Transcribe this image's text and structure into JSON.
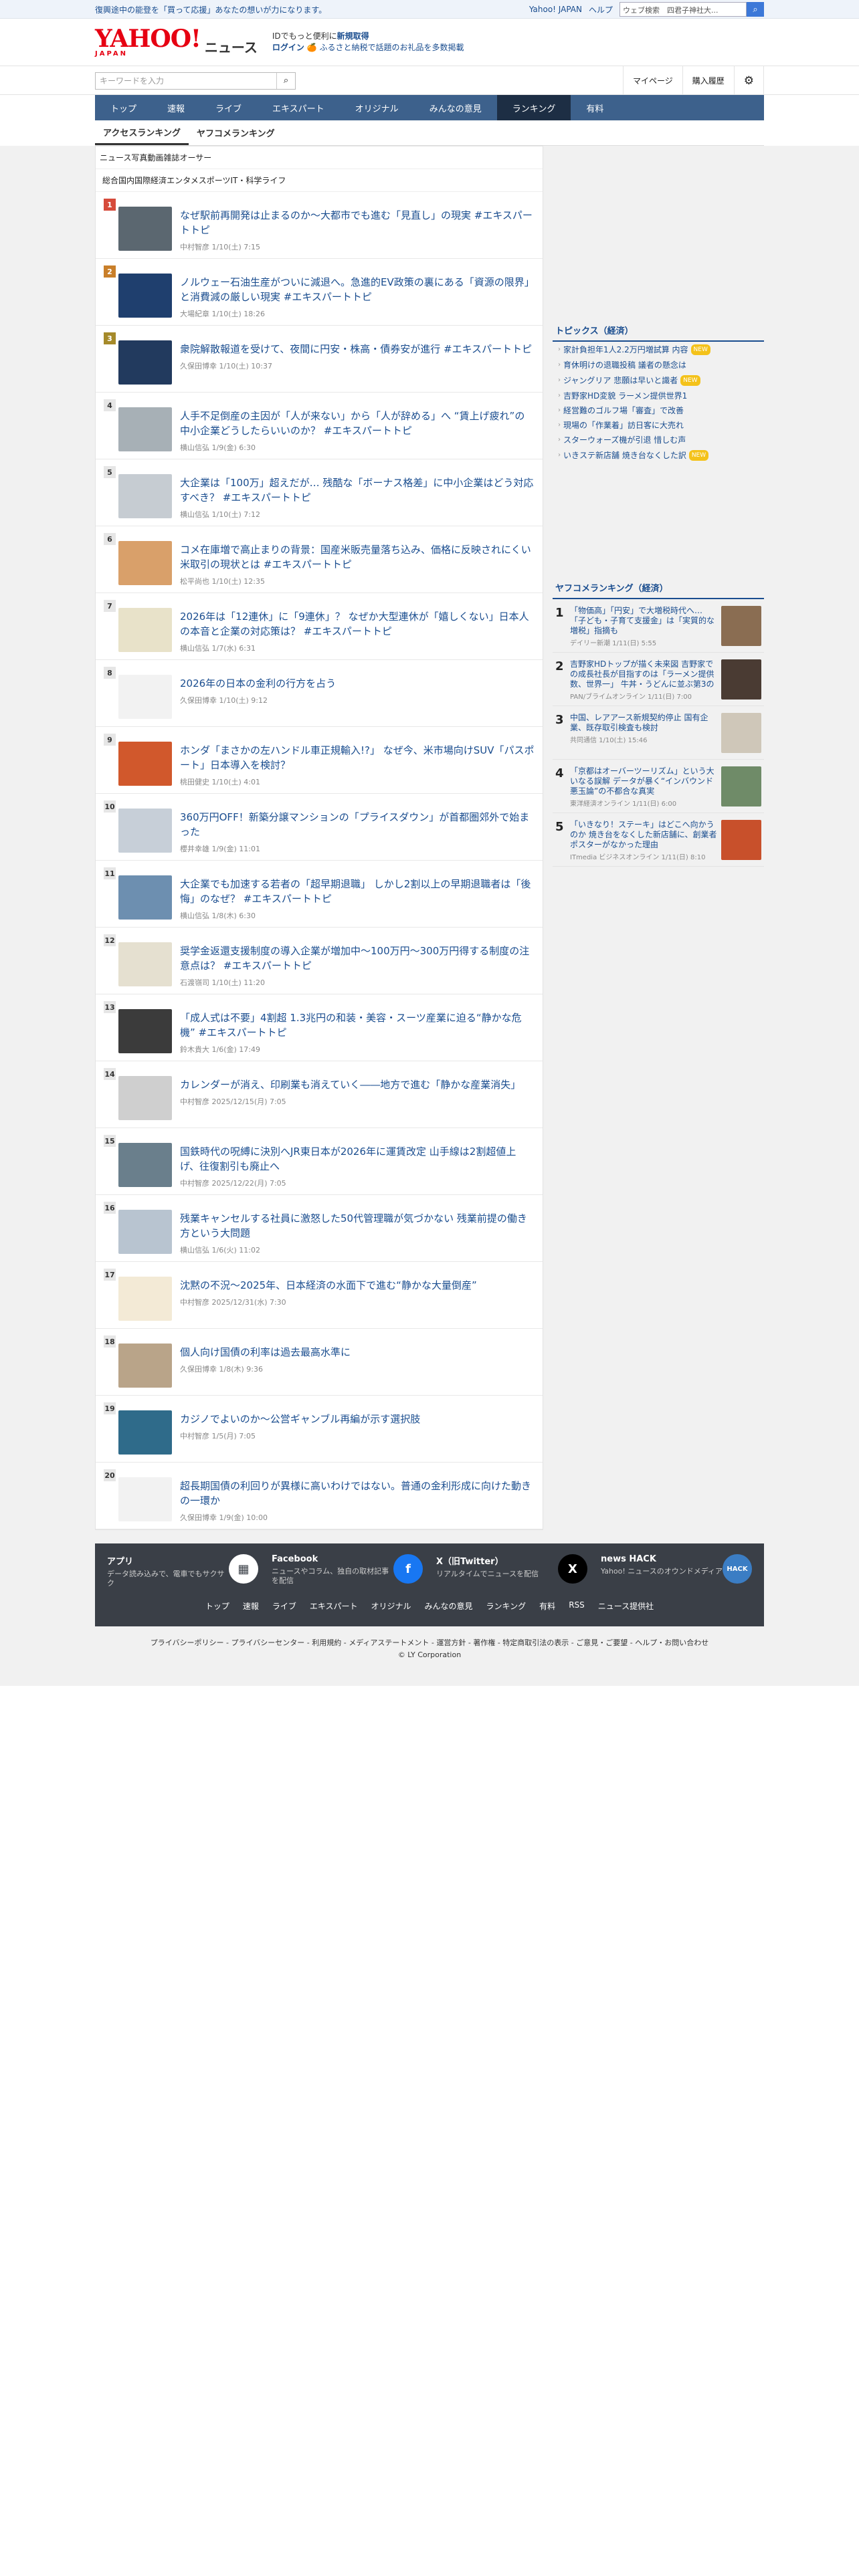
{
  "topbar": {
    "promo": "復興途中の能登を「買って応援」あなたの想いが力になります。",
    "yahoo_japan": "Yahoo! JAPAN",
    "help": "ヘルプ",
    "web_search": "ウェブ検索",
    "search_value": "四君子神社大..."
  },
  "header": {
    "logo_text": "YAHOO!",
    "logo_sub": "JAPAN",
    "logo_news": "ニュース",
    "pitch_line1_a": "IDでもっと便利に",
    "pitch_line1_b": "新規取得",
    "pitch_login": "ログイン",
    "pitch_line2": "ふるさと納税で話題のお礼品を多数掲載"
  },
  "search": {
    "placeholder": "キーワードを入力",
    "mypage": "マイページ",
    "history": "購入履歴"
  },
  "nav": [
    "トップ",
    "速報",
    "ライブ",
    "エキスパート",
    "オリジナル",
    "みんなの意見",
    "ランキング",
    "有料"
  ],
  "nav_active": 6,
  "subtabs": [
    "アクセスランキング",
    "ヤフコメランキング"
  ],
  "cat1": [
    "ニュース",
    "写真",
    "動画",
    "雑誌",
    "オーサー"
  ],
  "cat2": [
    "総合",
    "国内",
    "国際",
    "経済",
    "エンタメ",
    "スポーツ",
    "IT・科学",
    "ライフ"
  ],
  "ranking": [
    {
      "no": "1",
      "title": "なぜ駅前再開発は止まるのか～大都市でも進む「見直し」の現実 #エキスパートトピ",
      "meta": "中村智彦 1/10(土) 7:15"
    },
    {
      "no": "2",
      "title": "ノルウェー石油生産がついに減退へ。急進的EV政策の裏にある「資源の限界」と消費減の厳しい現実 #エキスパートトピ",
      "meta": "大場紀章 1/10(土) 18:26"
    },
    {
      "no": "3",
      "title": "衆院解散報道を受けて、夜間に円安・株高・債券安が進行 #エキスパートトピ",
      "meta": "久保田博幸 1/10(土) 10:37"
    },
    {
      "no": "4",
      "title": "人手不足倒産の主因が「人が来ない」から「人が辞める」へ “賃上げ疲れ”の中小企業どうしたらいいのか？ #エキスパートトピ",
      "meta": "横山信弘 1/9(金) 6:30"
    },
    {
      "no": "5",
      "title": "大企業は「100万」超えだが… 残酷な「ボーナス格差」に中小企業はどう対応すべき？ #エキスパートトピ",
      "meta": "横山信弘 1/10(土) 7:12"
    },
    {
      "no": "6",
      "title": "コメ在庫増で高止まりの背景：国産米販売量落ち込み、価格に反映されにくい米取引の現状とは #エキスパートトピ",
      "meta": "松平尚也 1/10(土) 12:35"
    },
    {
      "no": "7",
      "title": "2026年は「12連休」に「9連休」？ なぜか大型連休が「嬉しくない」日本人の本音と企業の対応策は？ #エキスパートトピ",
      "meta": "横山信弘 1/7(水) 6:31"
    },
    {
      "no": "8",
      "title": "2026年の日本の金利の行方を占う",
      "meta": "久保田博幸 1/10(土) 9:12"
    },
    {
      "no": "9",
      "title": "ホンダ「まさかの左ハンドル車正規輸入!?」 なぜ今、米市場向けSUV「パスポート」日本導入を検討？",
      "meta": "桃田健史 1/10(土) 4:01"
    },
    {
      "no": "10",
      "title": "360万円OFF！新築分譲マンションの「プライスダウン」が首都圏郊外で始まった",
      "meta": "櫻井幸雄 1/9(金) 11:01"
    },
    {
      "no": "11",
      "title": "大企業でも加速する若者の「超早期退職」 しかし2割以上の早期退職者は「後悔」のなぜ？ #エキスパートトピ",
      "meta": "横山信弘 1/8(木) 6:30"
    },
    {
      "no": "12",
      "title": "奨学金返還支援制度の導入企業が増加中～100万円～300万円得する制度の注意点は？ #エキスパートトピ",
      "meta": "石渡嶺司 1/10(土) 11:20"
    },
    {
      "no": "13",
      "title": "「成人式は不要」4割超 1.3兆円の和装・美容・スーツ産業に迫る“静かな危機” #エキスパートトピ",
      "meta": "鈴木貴大 1/6(金) 17:49"
    },
    {
      "no": "14",
      "title": "カレンダーが消え、印刷業も消えていく――地方で進む「静かな産業消失」",
      "meta": "中村智彦 2025/12/15(月) 7:05"
    },
    {
      "no": "15",
      "title": "国鉄時代の呪縛に決別へJR東日本が2026年に運賃改定 山手線は2割超値上げ、往復割引も廃止へ",
      "meta": "中村智彦 2025/12/22(月) 7:05"
    },
    {
      "no": "16",
      "title": "残業キャンセルする社員に激怒した50代管理職が気づかない 残業前提の働き方という大問題",
      "meta": "横山信弘 1/6(火) 11:02"
    },
    {
      "no": "17",
      "title": "沈黙の不況～2025年、日本経済の水面下で進む“静かな大量倒産”",
      "meta": "中村智彦 2025/12/31(水) 7:30"
    },
    {
      "no": "18",
      "title": "個人向け国債の利率は過去最高水準に",
      "meta": "久保田博幸 1/8(木) 9:36"
    },
    {
      "no": "19",
      "title": "カジノでよいのか～公営ギャンブル再編が示す選択肢",
      "meta": "中村智彦 1/5(月) 7:05"
    },
    {
      "no": "20",
      "title": "超長期国債の利回りが異様に高いわけではない。普通の金利形成に向けた動きの一環か",
      "meta": "久保田博幸 1/9(金) 10:00"
    }
  ],
  "thumb_colors": [
    "#5b6770",
    "#1f3f6e",
    "#223a5e",
    "#a7b0b6",
    "#c6ccd2",
    "#d9a06a",
    "#e8e2c9",
    "#f2f2f2",
    "#d1582c",
    "#c7cfd8",
    "#6d8fb0",
    "#e5e0d0",
    "#3b3b3b",
    "#cfcfcf",
    "#6a7f8c",
    "#b8c4d0",
    "#f3ead6",
    "#b9a489",
    "#2f6b8a",
    "#f2f2f2"
  ],
  "side": {
    "topics_title": "トピックス（経済）",
    "topics": [
      {
        "t": "家計負担年1人2.2万円増試算 内容",
        "new": "NEW"
      },
      {
        "t": "育休明けの退職投稿 議者の懸念は",
        "new": ""
      },
      {
        "t": "ジャングリア 悲願は早いと識者",
        "new": "NEW"
      },
      {
        "t": "吉野家HD変貌 ラーメン提供世界1",
        "new": ""
      },
      {
        "t": "経営難のゴルフ場「審査」で改善",
        "new": ""
      },
      {
        "t": "現場の「作業着」訪日客に大売れ",
        "new": ""
      },
      {
        "t": "スターウォーズ機が引退 惜しむ声",
        "new": ""
      },
      {
        "t": "いきステ新店舗 焼き台なくした訳",
        "new": "NEW"
      }
    ],
    "ycr_title": "ヤフコメランキング（経済）",
    "ycr": [
      {
        "n": "1",
        "t": "「物価高」「円安」で大増税時代へ… 「子ども・子育て支援金」は「実質的な増税」指摘も",
        "m": "デイリー新潮 1/11(日) 5:55",
        "c": "#8a6d52"
      },
      {
        "n": "2",
        "t": "吉野家HDトップが描く未来図 吉野家での成長社長が目指すのは「ラーメン提供数、世界一」 牛丼・うどんに並ぶ第3の柱へ",
        "m": "PAN/ブライムオンライン 1/11(日) 7:00",
        "c": "#4a3b33"
      },
      {
        "n": "3",
        "t": "中国、レアアース新規契約停止 国有企業、既存取引検査も検討",
        "m": "共同通信 1/10(土) 15:46",
        "c": "#cfc7b9"
      },
      {
        "n": "4",
        "t": "「京都はオーバーツーリズム」という大いなる誤解 データが暴く“インバウンド悪玉論”の不都合な真実",
        "m": "東洋経済オンライン 1/11(日) 6:00",
        "c": "#6f8b68"
      },
      {
        "n": "5",
        "t": "「いきなり！ステーキ」はどこへ向かうのか 焼き台をなくした新店舗に、創業者ポスターがなかった理由",
        "m": "ITmedia ビジネスオンライン 1/11(日) 8:10",
        "c": "#c8502b"
      }
    ]
  },
  "footer": {
    "cards": [
      {
        "ttl": "アプリ",
        "dsc": "データ読み込みで、電車でもサクサク",
        "ico": "▦",
        "color": "#ffffff",
        "fg": "#3a3f47"
      },
      {
        "ttl": "Facebook",
        "dsc": "ニュースやコラム、独自の取材記事を配信",
        "ico": "f",
        "color": "#1877f2",
        "fg": "#ffffff"
      },
      {
        "ttl": "X（旧Twitter）",
        "dsc": "リアルタイムでニュースを配信",
        "ico": "X",
        "color": "#000000",
        "fg": "#ffffff"
      },
      {
        "ttl": "news HACK",
        "dsc": "Yahoo! ニュースのオウンドメディア",
        "ico": "HACK",
        "color": "#3b7dc4",
        "fg": "#ffffff"
      }
    ],
    "links": [
      "トップ",
      "速報",
      "ライブ",
      "エキスパート",
      "オリジナル",
      "みんなの意見",
      "ランキング",
      "有料",
      "RSS",
      "ニュース提供社"
    ],
    "legal": "プライバシーポリシー - プライバシーセンター - 利用規約 - メディアステートメント - 運営方針 - 著作権 - 特定商取引法の表示 - ご意見・ご要望 - ヘルプ・お問い合わせ",
    "copyright": "© LY Corporation"
  }
}
